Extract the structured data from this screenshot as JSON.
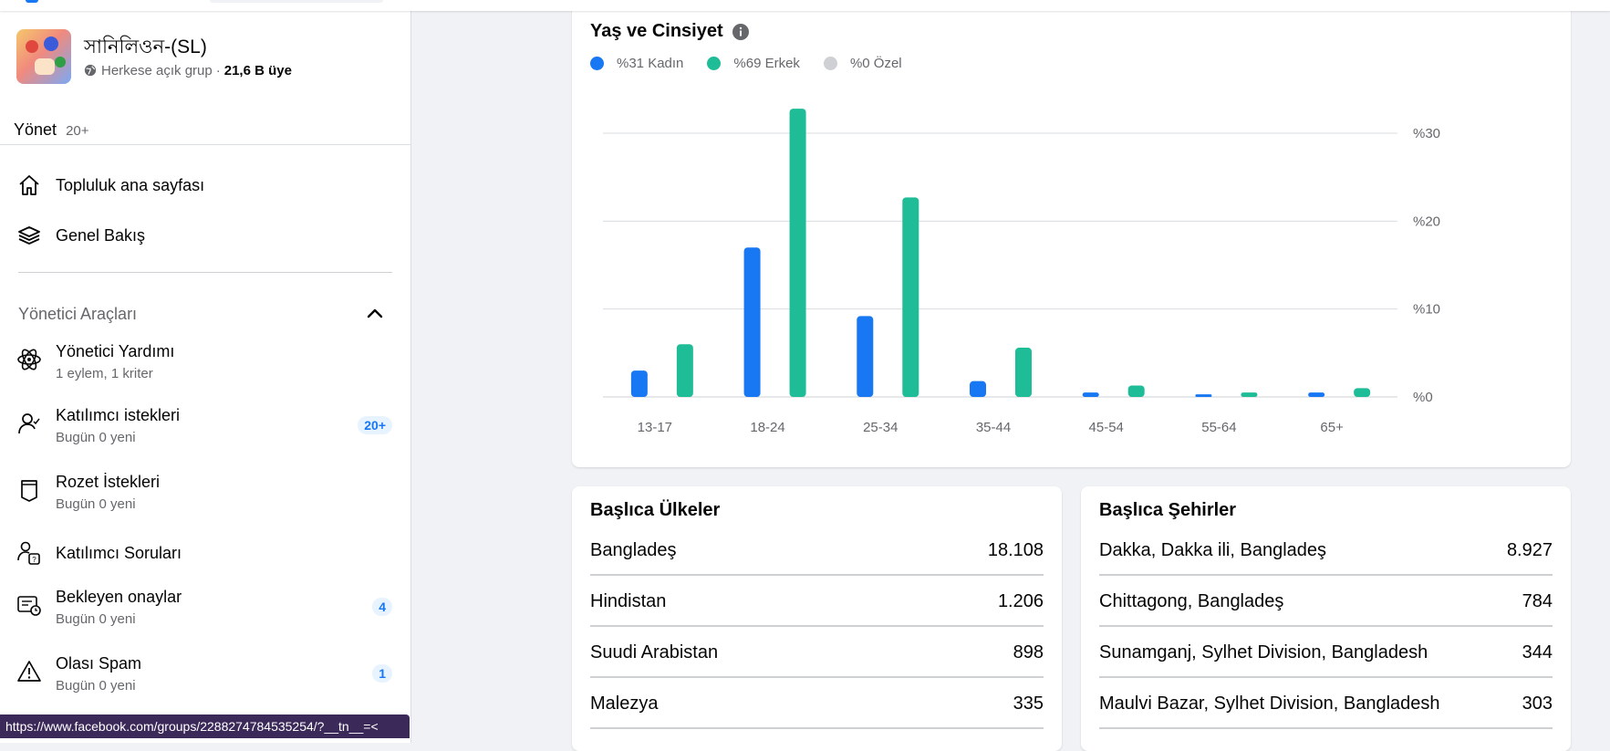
{
  "group": {
    "name": "সানিলিওন-(SL)",
    "privacy": "Herkese açık grup",
    "separator": "·",
    "members": "21,6 B üye"
  },
  "manage": {
    "label": "Yönet",
    "badge": "20+"
  },
  "nav": [
    {
      "label": "Topluluk ana sayfası",
      "icon": "home-icon"
    },
    {
      "label": "Genel Bakış",
      "icon": "layers-icon"
    }
  ],
  "admin_tools": {
    "title": "Yönetici Araçları",
    "items": [
      {
        "title": "Yönetici Yardımı",
        "subtitle": "1 eylem, 1 kriter",
        "badge": "",
        "icon": "admin-assist-icon"
      },
      {
        "title": "Katılımcı istekleri",
        "subtitle": "Bugün 0 yeni",
        "badge": "20+",
        "icon": "member-request-icon"
      },
      {
        "title": "Rozet İstekleri",
        "subtitle": "Bugün 0 yeni",
        "badge": "",
        "icon": "badge-icon"
      },
      {
        "title": "Katılımcı Soruları",
        "subtitle": "",
        "badge": "",
        "icon": "member-questions-icon"
      },
      {
        "title": "Bekleyen onaylar",
        "subtitle": "Bugün 0 yeni",
        "badge": "4",
        "icon": "pending-approvals-icon"
      },
      {
        "title": "Olası Spam",
        "subtitle": "Bugün 0 yeni",
        "badge": "1",
        "icon": "warning-icon"
      }
    ]
  },
  "status_url": "https://www.facebook.com/groups/2288274784535254/?__tn__=<",
  "chart_data": {
    "type": "bar",
    "title": "Yaş ve Cinsiyet",
    "legend": [
      {
        "label": "%31 Kadın",
        "color": "#1877f2"
      },
      {
        "label": "%69 Erkek",
        "color": "#1fbc98"
      },
      {
        "label": "%0 Özel",
        "color": "#ced0d4"
      }
    ],
    "categories": [
      "13-17",
      "18-24",
      "25-34",
      "35-44",
      "45-54",
      "55-64",
      "65+"
    ],
    "series": [
      {
        "name": "%31 Kadın",
        "color": "#1877f2",
        "values": [
          3.0,
          17.0,
          9.2,
          1.8,
          0.5,
          0.3,
          0.5
        ]
      },
      {
        "name": "%69 Erkek",
        "color": "#1fbc98",
        "values": [
          6.0,
          32.8,
          22.7,
          5.6,
          1.3,
          0.5,
          1.0
        ]
      }
    ],
    "yticks": [
      "%0",
      "%10",
      "%20",
      "%30"
    ],
    "ytick_values": [
      0,
      10,
      20,
      30
    ],
    "ylim": [
      0,
      30
    ],
    "grid": true,
    "ytick_side": "right"
  },
  "countries": {
    "title": "Başlıca Ülkeler",
    "rows": [
      {
        "name": "Bangladeş",
        "value": "18.108"
      },
      {
        "name": "Hindistan",
        "value": "1.206"
      },
      {
        "name": "Suudi Arabistan",
        "value": "898"
      },
      {
        "name": "Malezya",
        "value": "335"
      }
    ]
  },
  "cities": {
    "title": "Başlıca Şehirler",
    "rows": [
      {
        "name": "Dakka, Dakka ili, Bangladeş",
        "value": "8.927"
      },
      {
        "name": "Chittagong, Bangladeş",
        "value": "784"
      },
      {
        "name": "Sunamganj, Sylhet Division, Bangladesh",
        "value": "344"
      },
      {
        "name": "Maulvi Bazar, Sylhet Division, Bangladesh",
        "value": "303"
      }
    ]
  }
}
